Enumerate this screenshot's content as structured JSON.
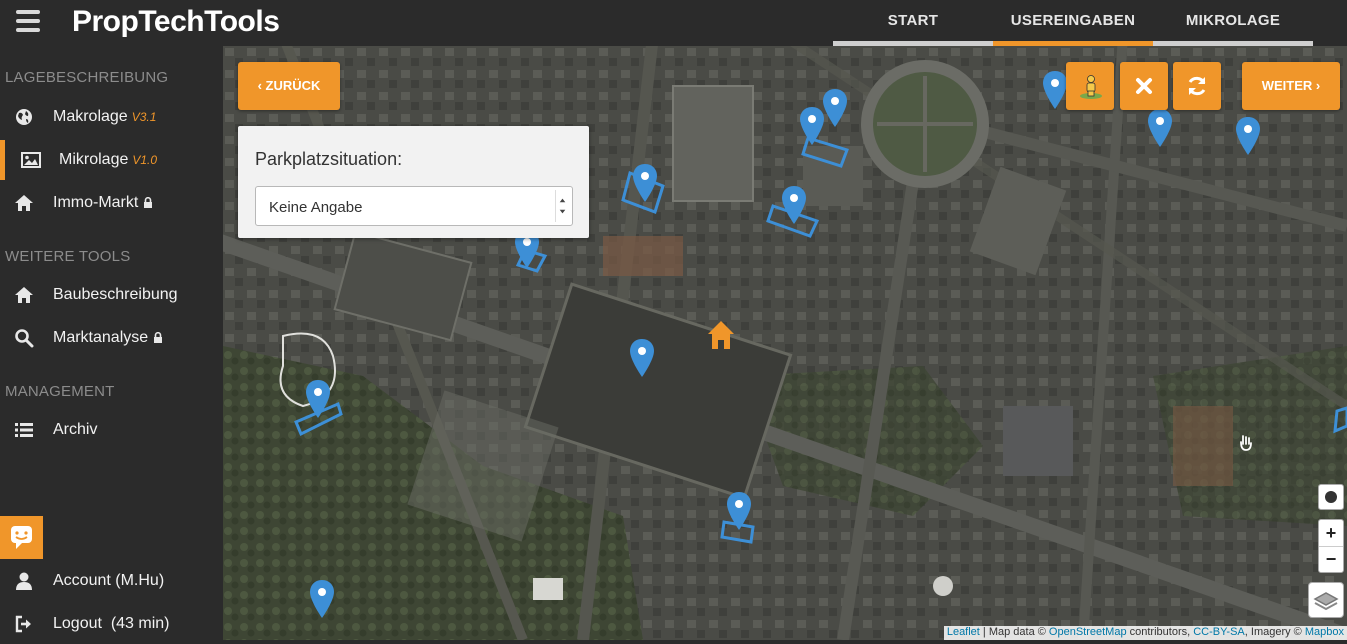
{
  "app": {
    "title": "PropTechTools"
  },
  "nav": {
    "tabs": [
      {
        "label": "START",
        "active": false
      },
      {
        "label": "USEREINGABEN",
        "active": true
      },
      {
        "label": "MIKROLAGE",
        "active": false
      }
    ]
  },
  "sidebar": {
    "sections": [
      "LAGEBESCHREIBUNG",
      "WEITERE TOOLS",
      "MANAGEMENT"
    ],
    "items": [
      {
        "label": "Makrolage",
        "version": "V3.1",
        "icon": "globe-icon",
        "locked": false
      },
      {
        "label": "Mikrolage",
        "version": "V1.0",
        "icon": "image-icon",
        "locked": false,
        "active": true
      },
      {
        "label": "Immo-Markt",
        "version": "",
        "icon": "home-icon",
        "locked": true
      },
      {
        "label": "Baubeschreibung",
        "version": "",
        "icon": "home-icon",
        "locked": false
      },
      {
        "label": "Marktanalyse",
        "version": "",
        "icon": "search-icon",
        "locked": true
      },
      {
        "label": "Archiv",
        "version": "",
        "icon": "list-icon",
        "locked": false
      }
    ],
    "account": {
      "label": "Account (M.Hu)",
      "icon": "user-icon"
    },
    "logout": {
      "label": "Logout  (43 min)",
      "icon": "logout-icon"
    }
  },
  "map": {
    "back_label": "ZURÜCK",
    "next_label": "WEITER",
    "tools": [
      "streetview-pegman-icon",
      "close-icon",
      "refresh-icon"
    ],
    "panel": {
      "label": "Parkplatzsituation:",
      "select_value": "Keine Angabe"
    },
    "zoom_in": "+",
    "zoom_out": "−",
    "attribution": {
      "leaflet": "Leaflet",
      "map_data": " | Map data © ",
      "osm": "OpenStreetMap",
      "contributors": " contributors, ",
      "license": "CC-BY-SA",
      "imagery": ", Imagery © ",
      "provider": "Mapbox"
    }
  },
  "colors": {
    "accent": "#f0962a",
    "sidebar_bg": "#2b2b2b",
    "marker": "#3d8fd6"
  }
}
